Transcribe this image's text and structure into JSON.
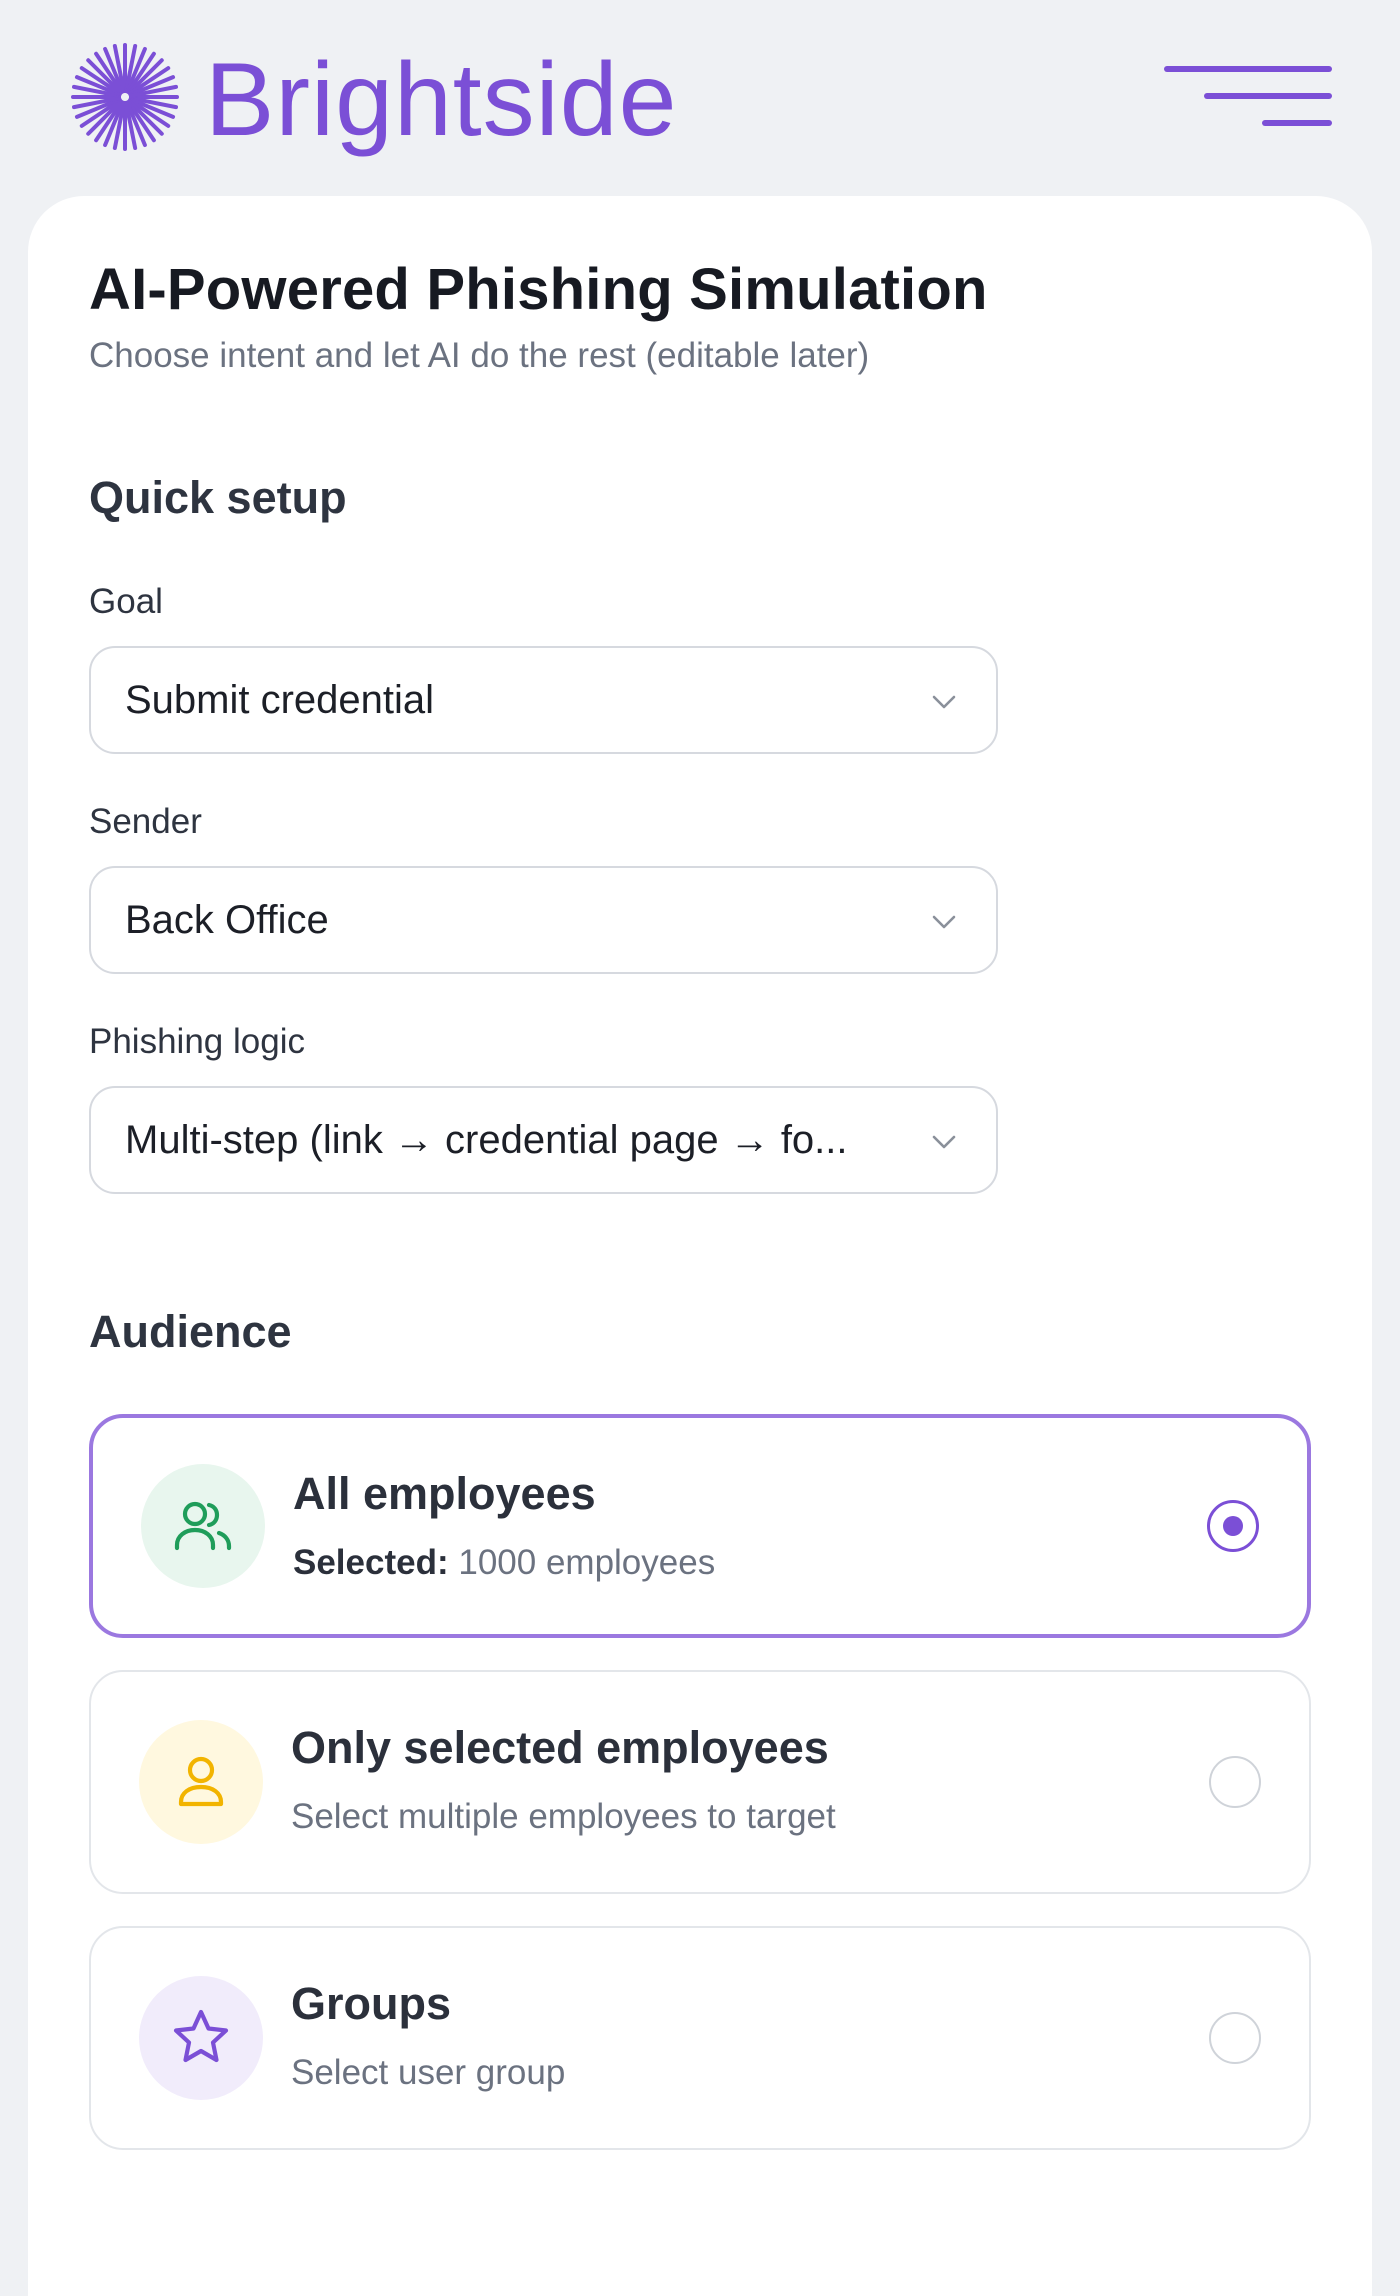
{
  "app": {
    "brand": "Brightside",
    "logo_icon": "sunburst-logo-icon",
    "menu_icon": "hamburger-menu-icon"
  },
  "colors": {
    "brand": "#7b4fd6",
    "background": "#eff1f4",
    "card": "#ffffff",
    "selected_border": "#9b78e0",
    "all_employees_icon": "#1f9d5a",
    "selected_employees_icon": "#f2b400",
    "groups_icon": "#7b4fd6"
  },
  "page": {
    "title": "AI-Powered Phishing Simulation",
    "subtitle": "Choose intent and let AI do the rest (editable later)"
  },
  "quick_setup": {
    "title": "Quick setup",
    "goal": {
      "label": "Goal",
      "value": "Submit credential"
    },
    "sender": {
      "label": "Sender",
      "value": "Back Office"
    },
    "phishing_logic": {
      "label": "Phishing logic",
      "value": "Multi-step (link → credential page → fo..."
    }
  },
  "audience": {
    "title": "Audience",
    "options": [
      {
        "title": "All employees",
        "sub_prefix": "Selected:",
        "sub": "1000 employees",
        "icon": "users-icon",
        "selected": true
      },
      {
        "title": "Only selected employees",
        "sub": "Select multiple employees to target",
        "icon": "user-icon",
        "selected": false
      },
      {
        "title": "Groups",
        "sub": "Select user group",
        "icon": "star-icon",
        "selected": false
      }
    ]
  }
}
